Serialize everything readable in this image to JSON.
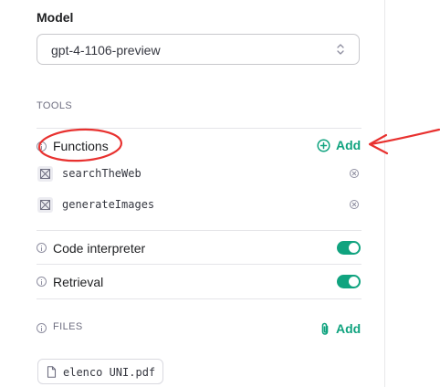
{
  "model": {
    "label": "Model",
    "selected": "gpt-4-1106-preview"
  },
  "tools": {
    "section_label": "TOOLS",
    "functions": {
      "label": "Functions",
      "add_label": "Add",
      "items": [
        {
          "name": "searchTheWeb"
        },
        {
          "name": "generateImages"
        }
      ]
    },
    "code_interpreter": {
      "label": "Code interpreter",
      "enabled": true
    },
    "retrieval": {
      "label": "Retrieval",
      "enabled": true
    }
  },
  "files": {
    "section_label": "FILES",
    "add_label": "Add",
    "items": [
      {
        "name": "elenco UNI.pdf"
      }
    ]
  },
  "colors": {
    "accent": "#10a37f",
    "annotation": "#e8312f"
  }
}
